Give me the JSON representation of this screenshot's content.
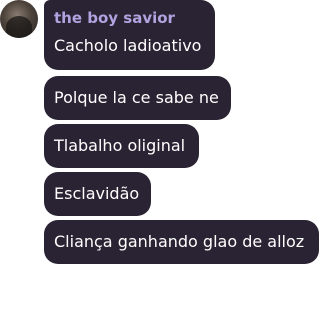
{
  "sender": {
    "name": "the boy savior"
  },
  "messages": [
    {
      "text": "Cacholo ladioativo"
    },
    {
      "text": "Polque la ce sabe ne"
    },
    {
      "text": "Tlabalho oliginal"
    },
    {
      "text": "Esclavidão"
    },
    {
      "text": "Cliança ganhando glao de alloz"
    }
  ],
  "colors": {
    "bubble": "#2a2333",
    "sender_name": "#b0a3e0",
    "text": "#ffffff",
    "background": "#ffffff"
  }
}
